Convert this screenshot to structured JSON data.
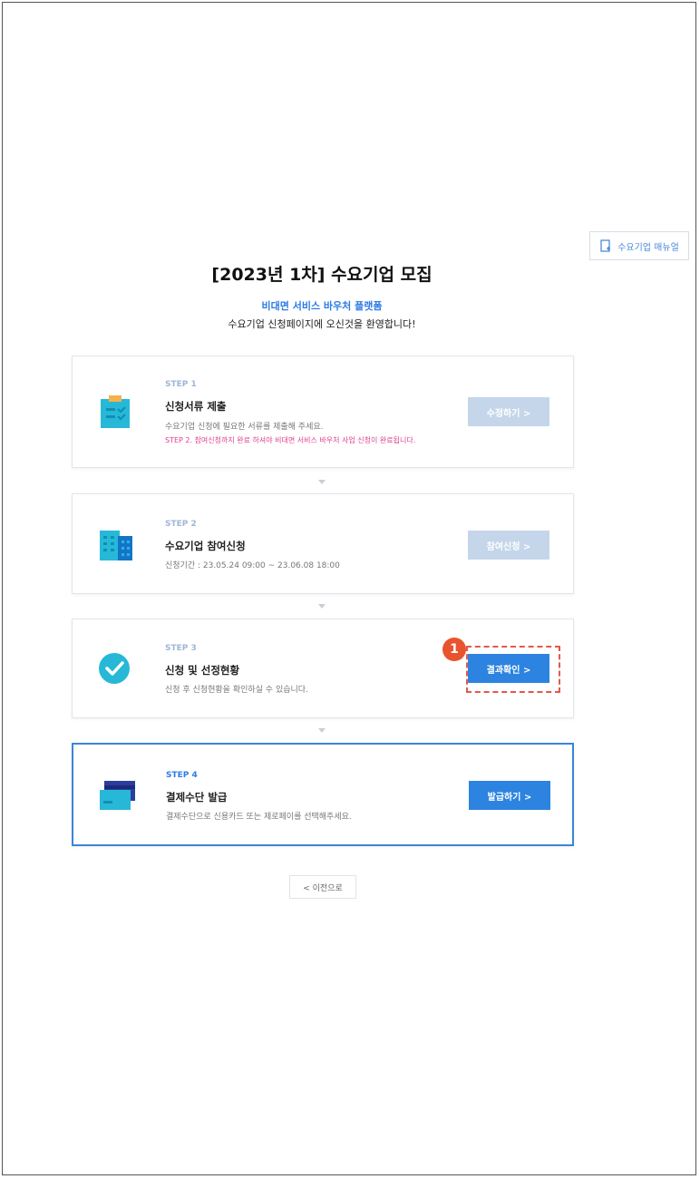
{
  "header": {
    "manual_button": "수요기업 매뉴얼",
    "title": "[2023년 1차] 수요기업 모집",
    "subtitle": "비대면 서비스 바우처 플랫폼",
    "welcome": "수요기업 신청페이지에 오신것을 환영합니다!"
  },
  "steps": [
    {
      "label": "STEP 1",
      "title": "신청서류 제출",
      "desc": "수요기업 신청에 필요한 서류를 제출해 주세요.",
      "note": "STEP 2. 참여신청까지 완료 하셔야 비대면 서비스 바우처 사업 신청이 완료됩니다.",
      "button": "수정하기 >",
      "icon": "clipboard-icon"
    },
    {
      "label": "STEP 2",
      "title": "수요기업 참여신청",
      "desc": "신청기간 : 23.05.24 09:00 ~ 23.06.08 18:00",
      "button": "참여신청 >",
      "icon": "building-icon"
    },
    {
      "label": "STEP 3",
      "title": "신청 및 선정현황",
      "desc": "신청 후 신청현황을 확인하실 수 있습니다.",
      "button": "결과확인 >",
      "icon": "check-circle-icon"
    },
    {
      "label": "STEP 4",
      "title": "결제수단 발급",
      "desc": "결제수단으로 신용카드 또는 제로페이를 선택해주세요.",
      "button": "발급하기 >",
      "icon": "card-icon"
    }
  ],
  "annotation": {
    "marker": "1"
  },
  "back_button": "< 이전으로",
  "colors": {
    "accent": "#2d83e0",
    "disabled": "#c5d6ea",
    "note": "#e0408a",
    "marker": "#e8542e"
  }
}
